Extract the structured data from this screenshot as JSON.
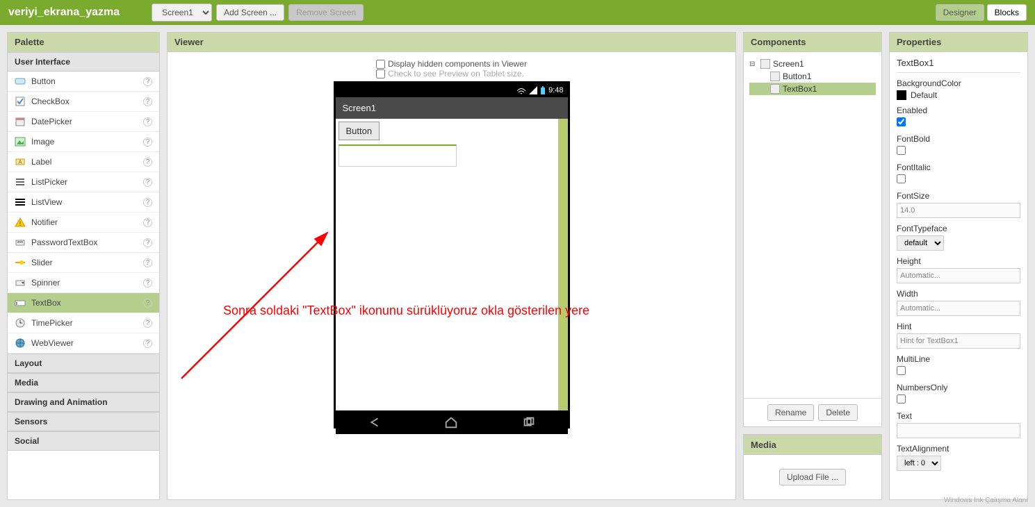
{
  "topbar": {
    "project_name": "veriyi_ekrana_yazma",
    "screen_select": "Screen1",
    "add_screen": "Add Screen ...",
    "remove_screen": "Remove Screen",
    "designer": "Designer",
    "blocks": "Blocks"
  },
  "palette": {
    "title": "Palette",
    "user_interface": "User Interface",
    "items": [
      {
        "label": "Button"
      },
      {
        "label": "CheckBox"
      },
      {
        "label": "DatePicker"
      },
      {
        "label": "Image"
      },
      {
        "label": "Label"
      },
      {
        "label": "ListPicker"
      },
      {
        "label": "ListView"
      },
      {
        "label": "Notifier"
      },
      {
        "label": "PasswordTextBox"
      },
      {
        "label": "Slider"
      },
      {
        "label": "Spinner"
      },
      {
        "label": "TextBox"
      },
      {
        "label": "TimePicker"
      },
      {
        "label": "WebViewer"
      }
    ],
    "cats": [
      "Layout",
      "Media",
      "Drawing and Animation",
      "Sensors",
      "Social"
    ]
  },
  "viewer": {
    "title": "Viewer",
    "opt_hidden": "Display hidden components in Viewer",
    "opt_tablet": "Check to see Preview on Tablet size.",
    "phone": {
      "time": "9:48",
      "screen_title": "Screen1",
      "button_label": "Button"
    },
    "annotation": "Sonra soldaki \"TextBox\" ikonunu sürüklüyoruz okla gösterilen yere"
  },
  "components": {
    "title": "Components",
    "tree": {
      "root": "Screen1",
      "c1": "Button1",
      "c2": "TextBox1"
    },
    "rename": "Rename",
    "delete": "Delete",
    "media_title": "Media",
    "upload": "Upload File ..."
  },
  "properties": {
    "title": "Properties",
    "component": "TextBox1",
    "bg_color_label": "BackgroundColor",
    "bg_color_value": "Default",
    "enabled": "Enabled",
    "fontbold": "FontBold",
    "fontitalic": "FontItalic",
    "fontsize_label": "FontSize",
    "fontsize_value": "14.0",
    "fonttypeface_label": "FontTypeface",
    "fonttypeface_value": "default",
    "height_label": "Height",
    "height_value": "Automatic...",
    "width_label": "Width",
    "width_value": "Automatic...",
    "hint_label": "Hint",
    "hint_value": "Hint for TextBox1",
    "multiline": "MultiLine",
    "numbersonly": "NumbersOnly",
    "text_label": "Text",
    "textalign_label": "TextAlignment",
    "textalign_value": "left : 0"
  },
  "watermark": "Windows Ink Çalışma Alanı"
}
